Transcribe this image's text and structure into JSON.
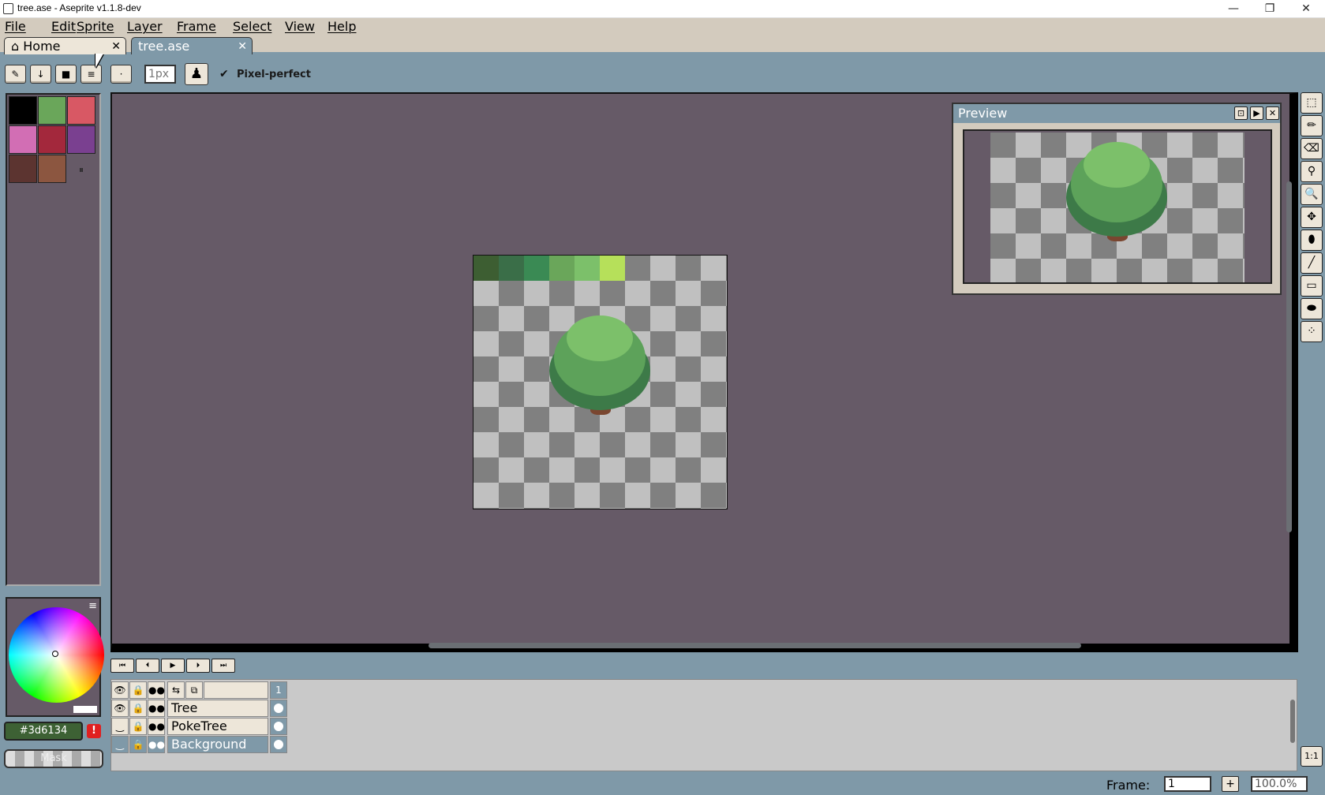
{
  "window": {
    "title": "tree.ase - Aseprite v1.1.8-dev",
    "controls": {
      "minimize": "—",
      "restore": "❐",
      "close": "✕"
    }
  },
  "menu": {
    "items": [
      "File",
      "Edit",
      "Sprite",
      "Layer",
      "Frame",
      "Select",
      "View",
      "Help"
    ]
  },
  "tabs": [
    {
      "label": "Home",
      "icon": "home-icon",
      "close": "✕"
    },
    {
      "label": "tree.ase",
      "close": "✕"
    }
  ],
  "toolbar": {
    "brush_size": "1px",
    "pixel_perfect_label": "Pixel-perfect",
    "pixel_perfect_checked": true,
    "buttons": [
      "✎",
      "↓",
      "■",
      "≡",
      "·"
    ],
    "ink_icon": "♟"
  },
  "palette": {
    "colors": [
      "#000000",
      "#6aa65a",
      "#d85864",
      "#d26eb4",
      "#a3283c",
      "#7a4090",
      "#5c3430",
      "#8c5640"
    ],
    "pause_icon": "⏸"
  },
  "color_picker": {
    "menu_icon": "≡",
    "hex_value": "#3d6134",
    "warning": "!",
    "mask_label": "Mask"
  },
  "sprite": {
    "palette_strip": [
      "#3d5e32",
      "#3a6e48",
      "#3a8a54",
      "#6aa65a",
      "#7cc06a",
      "#b6e05a"
    ]
  },
  "preview": {
    "title": "Preview",
    "buttons": [
      "⊡",
      "▶",
      "✕"
    ]
  },
  "tools": [
    {
      "name": "rectangular-marquee-icon",
      "glyph": "⬚"
    },
    {
      "name": "pencil-icon",
      "glyph": "✏"
    },
    {
      "name": "eraser-icon",
      "glyph": "⌫"
    },
    {
      "name": "eyedropper-icon",
      "glyph": "⚲"
    },
    {
      "name": "zoom-icon",
      "glyph": "🔍"
    },
    {
      "name": "move-icon",
      "glyph": "✥"
    },
    {
      "name": "paint-bucket-icon",
      "glyph": "⬮"
    },
    {
      "name": "line-icon",
      "glyph": "╱"
    },
    {
      "name": "rectangle-icon",
      "glyph": "▭"
    },
    {
      "name": "contour-icon",
      "glyph": "⬬"
    },
    {
      "name": "spray-icon",
      "glyph": "⁘"
    }
  ],
  "zoom_1to1": "1:1",
  "animation_controls": [
    "⏮",
    "⏴",
    "▶",
    "⏵",
    "⏭"
  ],
  "timeline": {
    "header_icons": [
      "👁",
      "🔒",
      "●●",
      "⇆",
      "⧉"
    ],
    "frame_number": "1",
    "layers": [
      {
        "name": "Tree",
        "visible": true,
        "selected": false
      },
      {
        "name": "PokeTree",
        "visible": false,
        "selected": false
      },
      {
        "name": "Background",
        "visible": false,
        "selected": true
      }
    ]
  },
  "status": {
    "frame_label": "Frame:",
    "frame_value": "1",
    "add_frame": "+",
    "zoom": "100.0%"
  }
}
